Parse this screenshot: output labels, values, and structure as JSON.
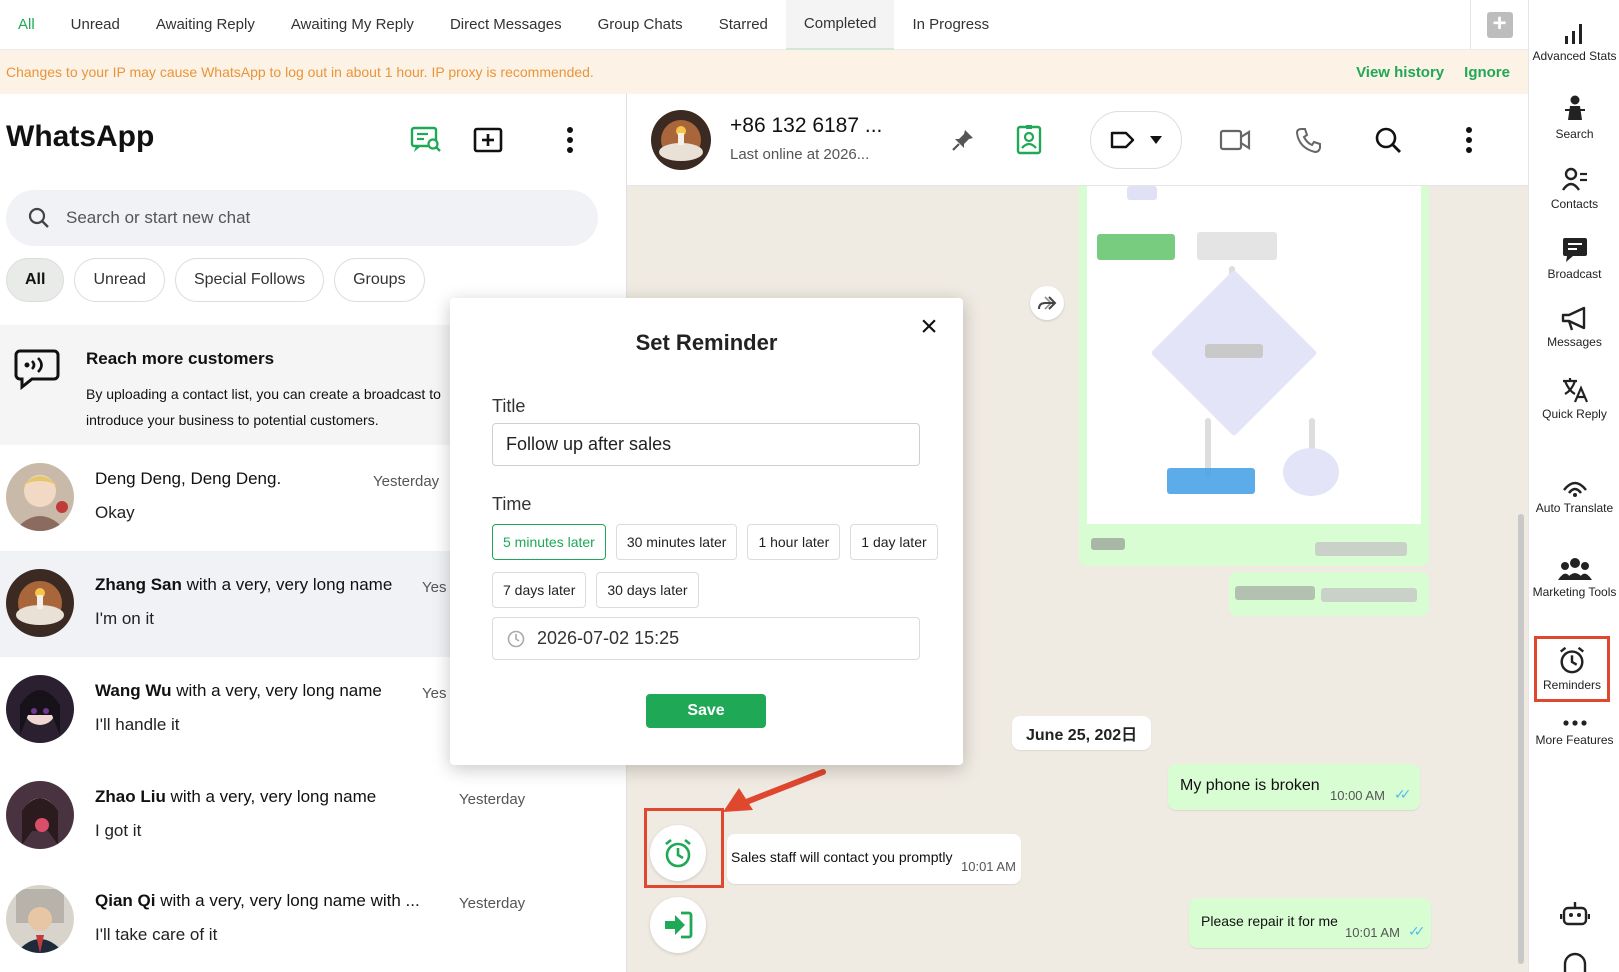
{
  "top_tabs": [
    "All",
    "Unread",
    "Awaiting Reply",
    "Awaiting My Reply",
    "Direct Messages",
    "Group Chats",
    "Starred",
    "Completed",
    "In Progress"
  ],
  "banner": {
    "text": "Changes to your IP may cause WhatsApp to log out in about 1 hour. IP proxy is recommended.",
    "view_history": "View history",
    "ignore": "Ignore"
  },
  "left": {
    "app_title": "WhatsApp",
    "search_placeholder": "Search or start new chat",
    "filters": [
      "All",
      "Unread",
      "Special Follows",
      "Groups"
    ],
    "promo": {
      "title": "Reach more customers",
      "text": "By uploading a contact list, you can create a broadcast to introduce your business to potential customers."
    },
    "chats": [
      {
        "name_bold": "",
        "name_rest": "Deng Deng, Deng Deng.",
        "time": "Yesterday",
        "message": "Okay"
      },
      {
        "name_bold": "Zhang San",
        "name_rest": " with a very, very long name",
        "time": "Yes",
        "message": "I'm on it"
      },
      {
        "name_bold": "Wang Wu",
        "name_rest": " with a very, very long name",
        "time": "Yes",
        "message": "I'll handle it"
      },
      {
        "name_bold": "Zhao Liu",
        "name_rest": " with a very, very long name",
        "time": "Yesterday",
        "message": "I got it"
      },
      {
        "name_bold": "Qian Qi",
        "name_rest": " with a very, very long name with ...",
        "time": "Yesterday",
        "message": "I'll take care of it"
      }
    ]
  },
  "chat": {
    "contact_name": "+86 132 6187 ...",
    "last_online": "Last online at 2026...",
    "date_chip": "June 25, 202日",
    "messages": [
      {
        "text": "My phone is broken",
        "time": "10:00 AM",
        "direction": "out"
      },
      {
        "text": "Sales staff will contact you promptly",
        "time": "10:01 AM",
        "direction": "in"
      },
      {
        "text": "Please repair it for me",
        "time": "10:01 AM",
        "direction": "out"
      }
    ]
  },
  "sidebar": [
    {
      "label": "Advanced Stats",
      "icon": "stats-icon"
    },
    {
      "label": "Search",
      "icon": "search-person-icon"
    },
    {
      "label": "Contacts",
      "icon": "contacts-icon"
    },
    {
      "label": "Broadcast",
      "icon": "broadcast-icon"
    },
    {
      "label": "Messages",
      "icon": "megaphone-icon"
    },
    {
      "label": "Quick Reply",
      "icon": "translate-icon"
    },
    {
      "label": "Auto Translate",
      "icon": "auto-translate-icon"
    },
    {
      "label": "Marketing Tools",
      "icon": "marketing-icon"
    },
    {
      "label": "Reminders",
      "icon": "alarm-icon"
    },
    {
      "label": "More Features",
      "icon": "more-icon"
    }
  ],
  "modal": {
    "title": "Set Reminder",
    "title_label": "Title",
    "title_value": "Follow up after sales",
    "time_label": "Time",
    "time_options": [
      "5 minutes later",
      "30 minutes later",
      "1 hour later",
      "1 day later",
      "7 days later",
      "30 days later"
    ],
    "selected_time_option": "5 minutes later",
    "datetime": "2026-07-02 15:25",
    "save": "Save"
  },
  "colors": {
    "accent": "#1fa855",
    "warning": "#e8953a",
    "highlight": "#e0472f",
    "bubble_out": "#d9fdd3"
  }
}
